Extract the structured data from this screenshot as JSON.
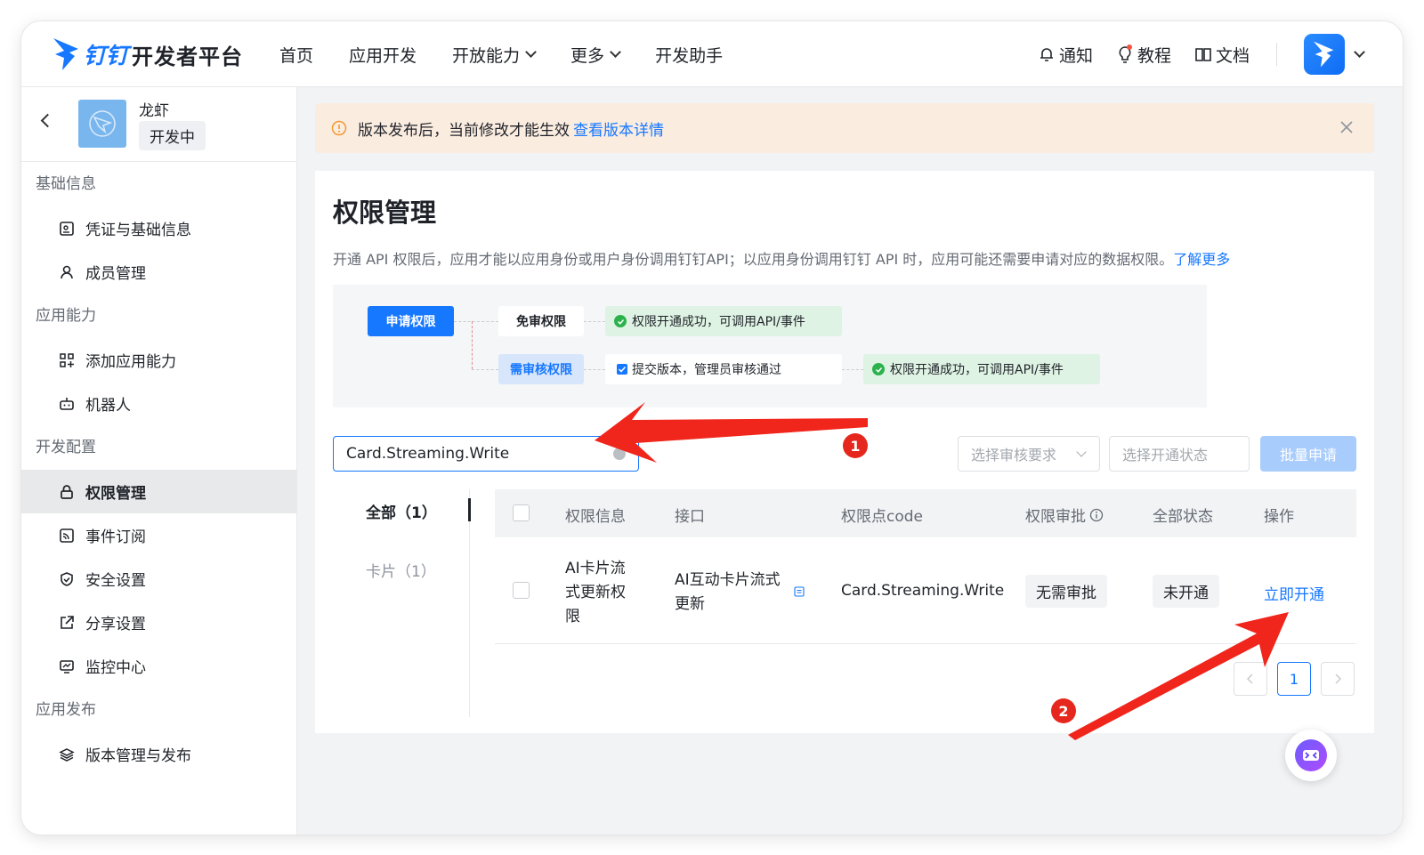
{
  "topbar": {
    "logo_ding": "钉钉",
    "logo_text": "开发者平台",
    "nav": [
      "首页",
      "应用开发",
      "开放能力",
      "更多",
      "开发助手"
    ],
    "tools": {
      "notice": "通知",
      "tutorial": "教程",
      "docs": "文档"
    }
  },
  "app": {
    "name": "龙虾",
    "status": "开发中"
  },
  "sidebar": {
    "sections": [
      "基础信息",
      "应用能力",
      "开发配置",
      "应用发布"
    ],
    "items": [
      "凭证与基础信息",
      "成员管理",
      "添加应用能力",
      "机器人",
      "权限管理",
      "事件订阅",
      "安全设置",
      "分享设置",
      "监控中心",
      "版本管理与发布"
    ]
  },
  "notice": {
    "text": "版本发布后，当前修改才能生效",
    "link": "查看版本详情"
  },
  "page": {
    "title": "权限管理",
    "desc": "开通 API 权限后，应用才能以应用身份或用户身份调用钉钉API；以应用身份调用钉钉 API 时，应用可能还需要申请对应的数据权限。",
    "desc_link": "了解更多"
  },
  "flow": {
    "apply": "申请权限",
    "free": "免审权限",
    "free_result": "权限开通成功，可调用API/事件",
    "review": "需审核权限",
    "review_step": "提交版本，管理员审核通过",
    "review_result": "权限开通成功，可调用API/事件"
  },
  "filters": {
    "search_value": "Card.Streaming.Write",
    "review_select": "选择审核要求",
    "status_select": "选择开通状态",
    "batch": "批量申请"
  },
  "tabs": [
    "全部（1）",
    "卡片（1）"
  ],
  "table": {
    "headers": [
      "权限信息",
      "接口",
      "权限点code",
      "权限审批",
      "全部状态",
      "操作"
    ],
    "rows": [
      {
        "perm_l1": "AI卡片流",
        "perm_l2": "式更新权",
        "perm_l3": "限",
        "api_l1": "AI互动卡片流式",
        "api_l2": "更新",
        "code": "Card.Streaming.Write",
        "approval": "无需审批",
        "status": "未开通",
        "action": "立即开通"
      }
    ]
  },
  "pager": {
    "current": "1"
  },
  "annotations": {
    "badge1": "1",
    "badge2": "2"
  },
  "colors": {
    "accent": "#1677ff",
    "annotation": "#e6271d",
    "notice_bg": "#fbece0",
    "success_bg": "#dff3e4"
  }
}
